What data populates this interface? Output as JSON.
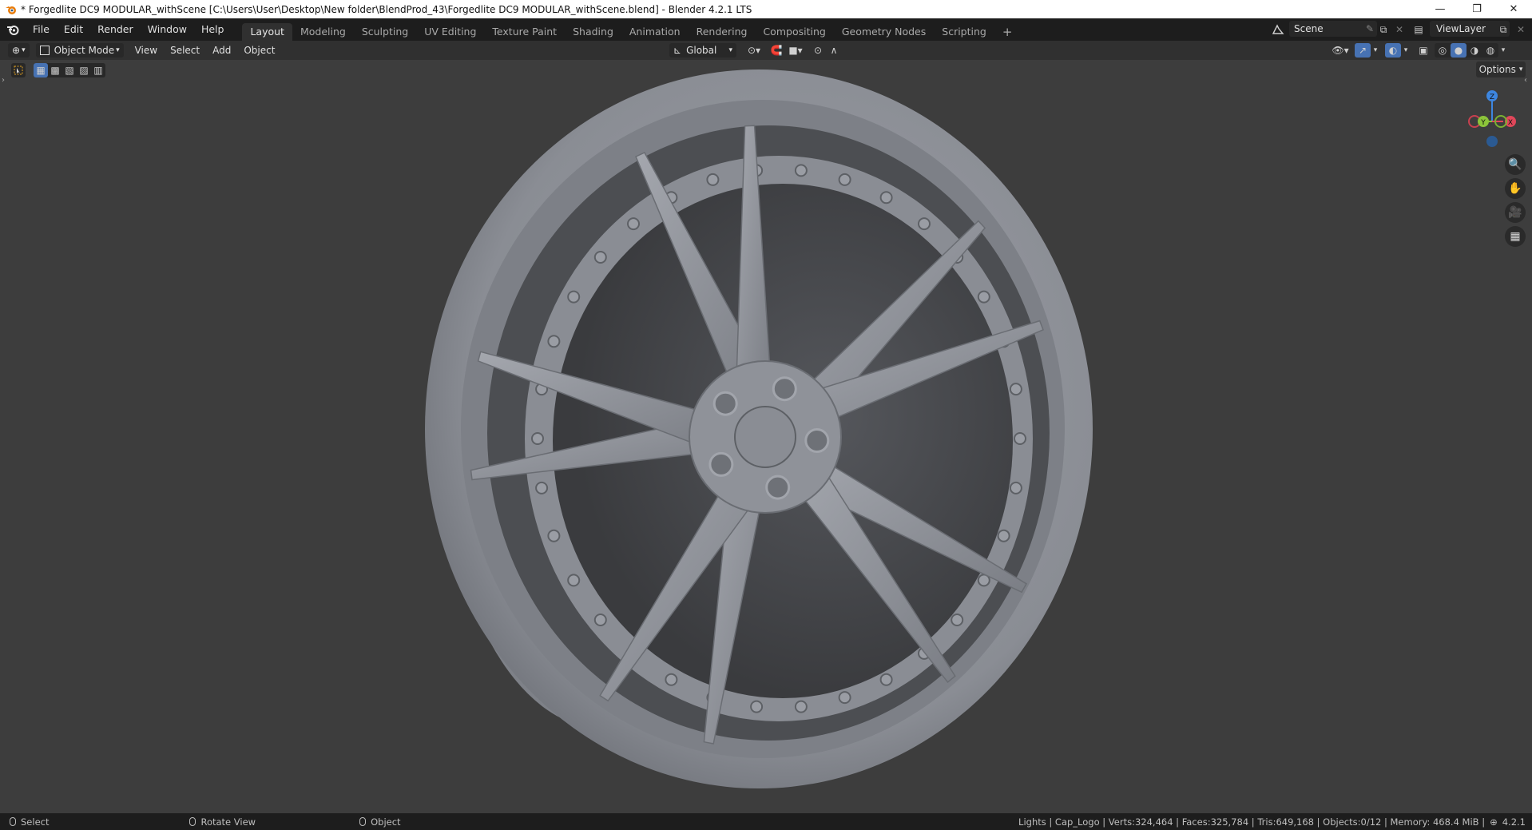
{
  "window": {
    "title": "* Forgedlite DC9 MODULAR_withScene [C:\\Users\\User\\Desktop\\New folder\\BlendProd_43\\Forgedlite DC9 MODULAR_withScene.blend] - Blender 4.2.1 LTS",
    "minimize": "—",
    "restore": "❐",
    "close": "✕"
  },
  "menubar": {
    "items": [
      "File",
      "Edit",
      "Render",
      "Window",
      "Help"
    ]
  },
  "workspaces": {
    "tabs": [
      "Layout",
      "Modeling",
      "Sculpting",
      "UV Editing",
      "Texture Paint",
      "Shading",
      "Animation",
      "Rendering",
      "Compositing",
      "Geometry Nodes",
      "Scripting"
    ],
    "active": "Layout",
    "add": "+"
  },
  "scene": {
    "label": "Scene"
  },
  "view_layer": {
    "label": "ViewLayer"
  },
  "viewport_header": {
    "mode": "Object Mode",
    "menus": [
      "View",
      "Select",
      "Add",
      "Object"
    ],
    "orientation": "Global",
    "options": "Options"
  },
  "gizmo": {
    "z": "Z",
    "y": "Y",
    "x": "X"
  },
  "statusbar": {
    "select": "Select",
    "rotate": "Rotate View",
    "object": "Object",
    "stats": "Lights | Cap_Logo | Verts:324,464 | Faces:325,784 | Tris:649,168 | Objects:0/12 | Memory: 468.4 MiB |",
    "version": "4.2.1"
  },
  "colors": {
    "accent_blue": "#4772b3",
    "axis_x": "#e0475a",
    "axis_y": "#8cc43a",
    "axis_z": "#3d86e0",
    "wheel": "#8e9198",
    "background": "#3d3d3d"
  }
}
